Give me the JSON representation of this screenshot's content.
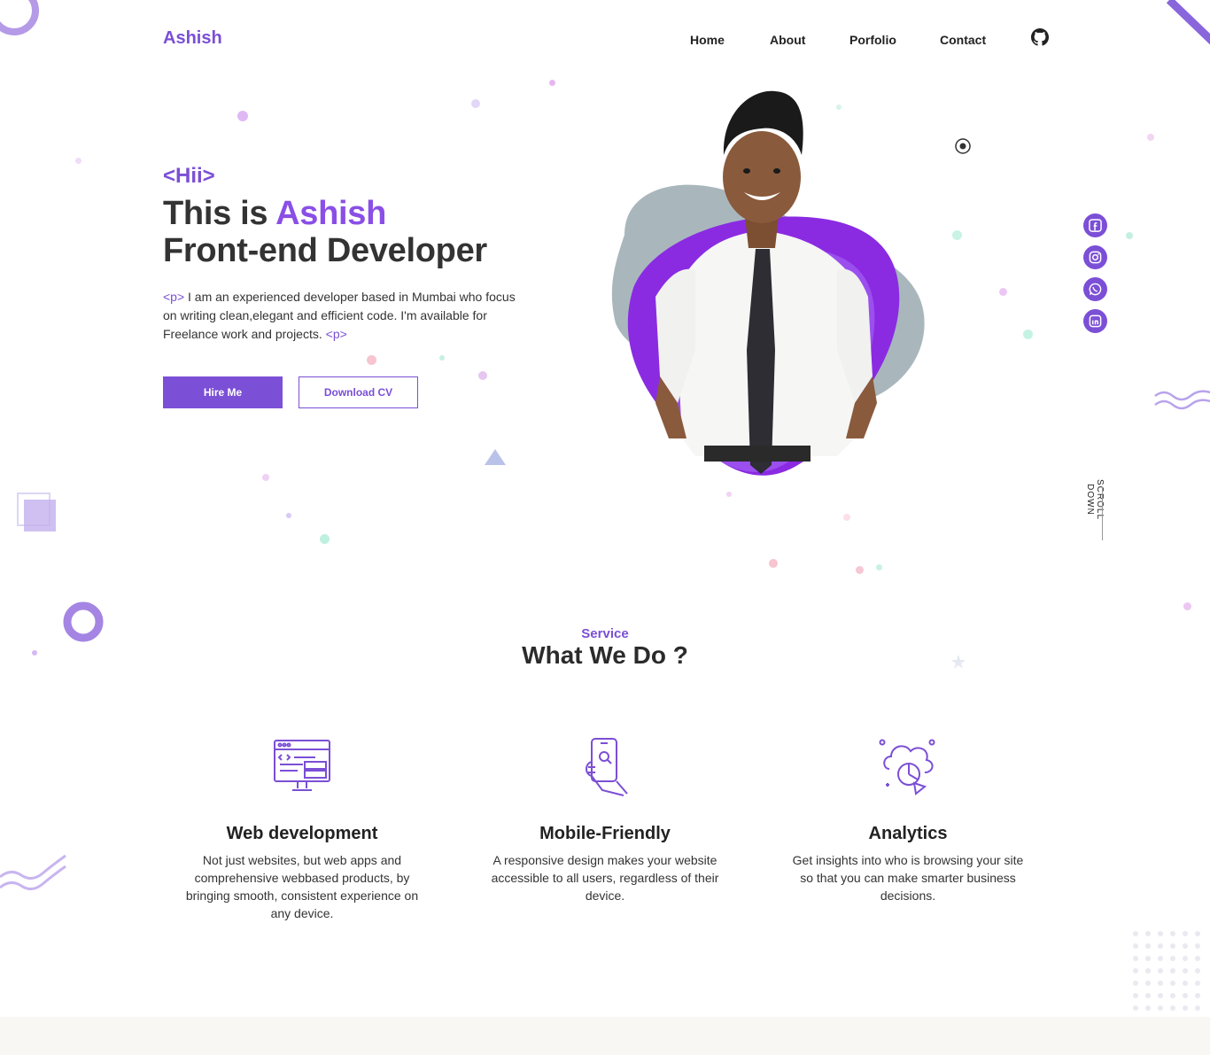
{
  "header": {
    "logo": "Ashish",
    "nav": [
      "Home",
      "About",
      "Porfolio",
      "Contact"
    ],
    "github_icon": "github-icon"
  },
  "hero": {
    "greeting": "<Hii>",
    "line1_prefix": "This is ",
    "line1_name": "Ashish",
    "line2": "Front-end Developer",
    "intro_open_tag": "<p>",
    "intro_text": " I am an experienced developer based in Mumbai who focus on writing clean,elegant and efficient code. I'm available for Freelance work and projects. ",
    "intro_close_tag": "<p>",
    "hire_button": "Hire Me",
    "cv_button": "Download CV",
    "scroll_label": "SCROLL DOWN"
  },
  "social": [
    {
      "icon": "facebook-icon"
    },
    {
      "icon": "instagram-icon"
    },
    {
      "icon": "whatsapp-icon"
    },
    {
      "icon": "linkedin-icon"
    }
  ],
  "services": {
    "kicker": "Service",
    "title": "What We Do ?",
    "items": [
      {
        "icon": "web-development-icon",
        "title": "Web development",
        "text": "Not just websites, but web apps and comprehensive webbased products, by bringing smooth, consistent experience on any device."
      },
      {
        "icon": "mobile-phone-icon",
        "title": "Mobile-Friendly",
        "text": "A responsive design makes your website accessible to all users, regardless of their device."
      },
      {
        "icon": "analytics-icon",
        "title": "Analytics",
        "text": "Get insights into who is browsing your site so that you can make smarter business decisions."
      }
    ]
  },
  "colors": {
    "accent": "#7b4fd6",
    "accent_bright": "#8a2be2",
    "blob_gray": "#a9b7bd",
    "text": "#2b2b2b"
  }
}
